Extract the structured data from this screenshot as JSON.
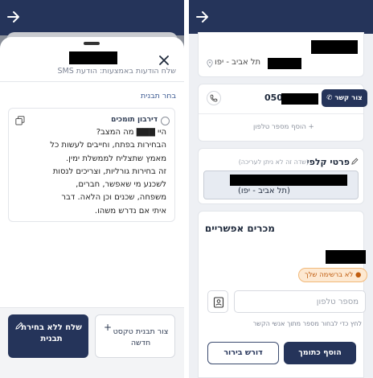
{
  "left": {
    "sheet": {
      "subtitle": "שלח הודעות באמצעות: הודעת SMS",
      "section_label": "בחר תבנית"
    },
    "template": {
      "title": "דירבון תומכים",
      "lines": [
        "היי ▇▇▇ מה המצב?",
        "הבחירות בפתח, וחייבים לעשות כל",
        "מאמץ שתצליח לממשלת ימין.",
        "זה בחירות גורליות, וצריכים לנסות",
        "לשכנע מי שאפשר, חברים,",
        "משפחה, שכנים וכן הלאה. דבר",
        "איתי אם נדרש משהו."
      ]
    },
    "footer": {
      "no_template_label": "שלח ללא בחירת תבנית",
      "new_template_label": "צור תבנית טקסט חדשה"
    }
  },
  "right": {
    "address": {
      "city": "תל אביב - יפו"
    },
    "phone": {
      "number_prefix": "050",
      "contact_button": "צור קשר",
      "add_phone": "+ הוסף מספר טלפון"
    },
    "ballot": {
      "title": "פרטי קלפי",
      "hint": "(שדה זה לא ניתן לעריכה)",
      "city": "(תל אביב - יפו)"
    },
    "sellers": {
      "title": "מכרים אפשריים",
      "badge": "● לא ברשימה שלך",
      "phone_placeholder": "מספר טלפון",
      "help": "לחץ כדי לבחור מספר מתוך אנשי הקשר",
      "add_button": "הוסף כתומך",
      "review_button": "דורש בירור"
    }
  }
}
